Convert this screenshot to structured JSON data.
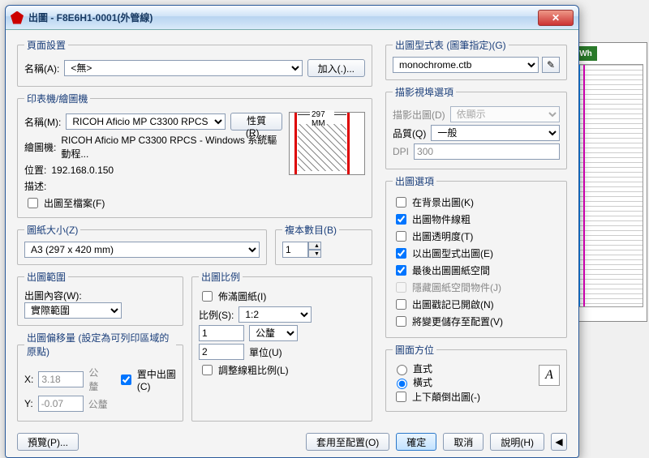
{
  "window": {
    "title": "出圖 - F8E6H1-0001(外管線)"
  },
  "pageSetup": {
    "legend": "頁面設置",
    "name_label": "名稱(A):",
    "name_value": "<無>",
    "add_btn": "加入(.)..."
  },
  "printer": {
    "legend": "印表機/繪圖機",
    "name_label": "名稱(M):",
    "name_value": "RICOH Aficio MP C3300 RPCS",
    "props_btn": "性質(R)...",
    "plotter_label": "繪圖機:",
    "plotter_value": "RICOH Aficio MP C3300 RPCS - Windows 系統驅動程...",
    "location_label": "位置:",
    "location_value": "192.168.0.150",
    "desc_label": "描述:",
    "to_file_label": "出圖至檔案(F)",
    "preview_dim": "297 MM"
  },
  "paper": {
    "legend": "圖紙大小(Z)",
    "value": "A3 (297 x 420 mm)",
    "copies_label": "複本數目(B)",
    "copies_value": "1"
  },
  "plotArea": {
    "legend": "出圖範圍",
    "what_label": "出圖內容(W):",
    "what_value": "實際範圍"
  },
  "offset": {
    "legend": "出圖偏移量 (設定為可列印區域的原點)",
    "x_label": "X:",
    "x_value": "3.18",
    "x_unit": "公釐",
    "y_label": "Y:",
    "y_value": "-0.07",
    "y_unit": "公釐",
    "center_label": "置中出圖(C)"
  },
  "scale": {
    "legend": "出圖比例",
    "fit_label": "佈滿圖紙(I)",
    "scale_label": "比例(S):",
    "scale_value": "1:2",
    "num_value": "1",
    "unit_select": "公釐",
    "den_value": "2",
    "den_unit": "單位(U)",
    "linewt_label": "調整線粗比例(L)"
  },
  "styleTable": {
    "legend": "出圖型式表 (圖筆指定)(G)",
    "value": "monochrome.ctb"
  },
  "shaded": {
    "legend": "描影視埠選項",
    "shade_label": "描影出圖(D)",
    "shade_value": "依顯示",
    "quality_label": "品質(Q)",
    "quality_value": "一般",
    "dpi_label": "DPI",
    "dpi_value": "300"
  },
  "options": {
    "legend": "出圖選項",
    "bg": "在背景出圖(K)",
    "linewt": "出圖物件線粗",
    "transp": "出圖透明度(T)",
    "styles": "以出圖型式出圖(E)",
    "last": "最後出圖圖紙空間",
    "hide": "隱藏圖紙空間物件(J)",
    "stamp": "出圖戳記已開啟(N)",
    "save": "將變更儲存至配置(V)"
  },
  "orient": {
    "legend": "圖面方位",
    "portrait": "直式",
    "landscape": "橫式",
    "upside": "上下顛倒出圖(-)"
  },
  "footer": {
    "preview": "預覽(P)...",
    "apply": "套用至配置(O)",
    "ok": "確定",
    "cancel": "取消",
    "help": "說明(H)"
  }
}
